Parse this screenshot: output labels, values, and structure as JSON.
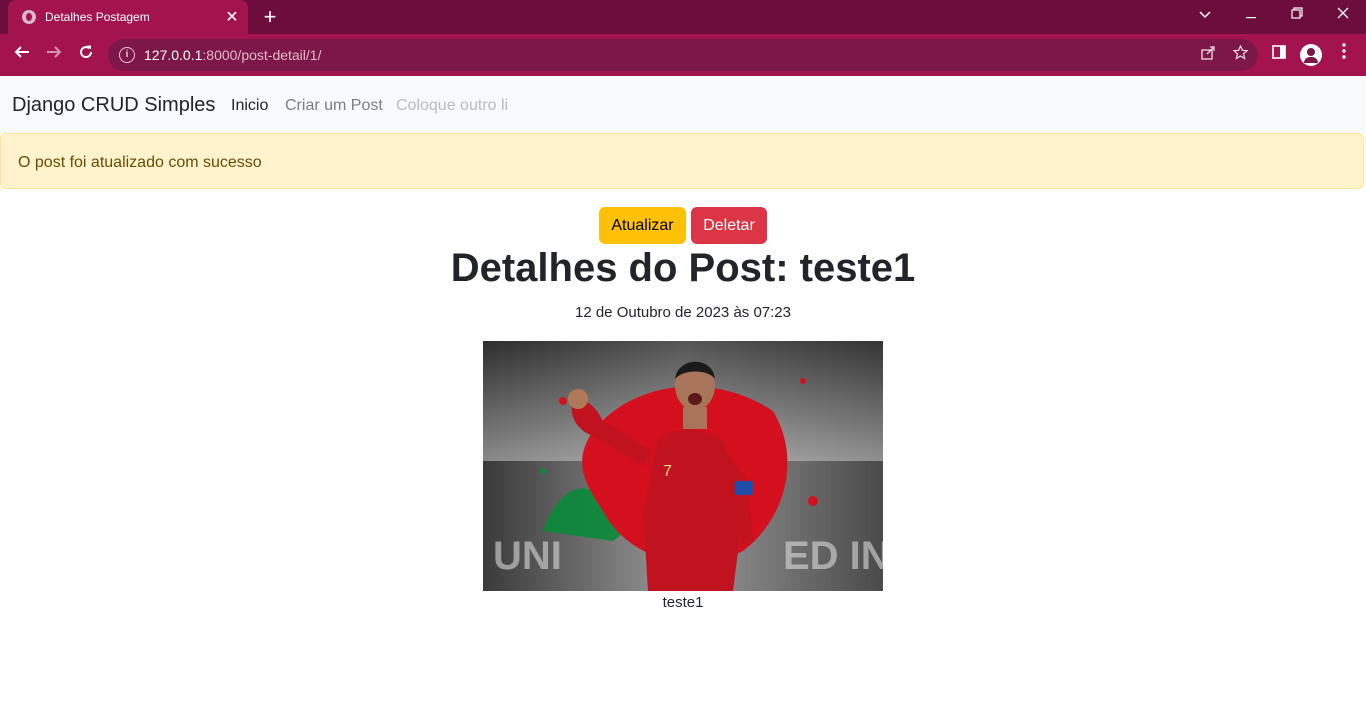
{
  "browser": {
    "tab_title": "Detalhes Postagem",
    "tab_close": "✕",
    "new_tab": "+",
    "url_host": "127.0.0.1",
    "url_rest": ":8000/post-detail/1/"
  },
  "navbar": {
    "brand": "Django CRUD Simples",
    "links": [
      {
        "label": "Inicio",
        "color": "#212529"
      },
      {
        "label": "Criar um Post",
        "color": "#7a7f84"
      },
      {
        "label": "Coloque outro li",
        "color": "#b8bbbf"
      }
    ]
  },
  "alert": {
    "message": "O post foi atualizado com sucesso"
  },
  "actions": {
    "update_label": "Atualizar",
    "delete_label": "Deletar"
  },
  "post": {
    "heading": "Detalhes do Post: teste1",
    "date": "12 de Outubro de 2023 às 07:23",
    "image_caption": "teste1"
  },
  "colors": {
    "tab_bar": "#6d0d3b",
    "toolbar": "#a3134e",
    "warning": "#ffc107",
    "danger": "#dc3545",
    "alert_bg": "#fff3cd"
  }
}
